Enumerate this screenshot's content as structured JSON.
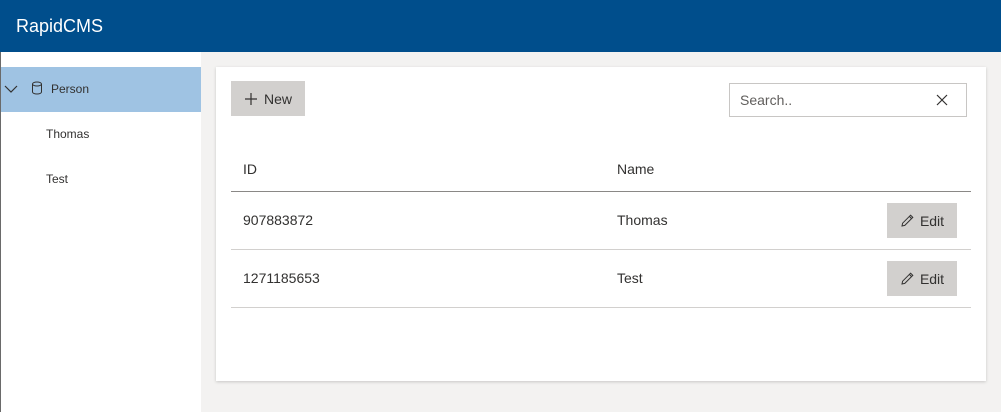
{
  "app": {
    "title": "RapidCMS"
  },
  "sidebar": {
    "collection": {
      "label": "Person",
      "expanded": true,
      "icon": "database-icon"
    },
    "items": [
      {
        "label": "Thomas"
      },
      {
        "label": "Test"
      }
    ]
  },
  "toolbar": {
    "new_label": "New",
    "new_icon": "plus-icon"
  },
  "search": {
    "placeholder": "Search..",
    "value": "",
    "clear_icon": "close-icon"
  },
  "table": {
    "columns": [
      "ID",
      "Name"
    ],
    "rows": [
      {
        "id": "907883872",
        "name": "Thomas",
        "action": "Edit"
      },
      {
        "id": "1271185653",
        "name": "Test",
        "action": "Edit"
      }
    ]
  },
  "colors": {
    "header": "#004e8c",
    "selected": "#9fc3e3",
    "button": "#d2d0ce",
    "content_bg": "#f3f2f1"
  }
}
